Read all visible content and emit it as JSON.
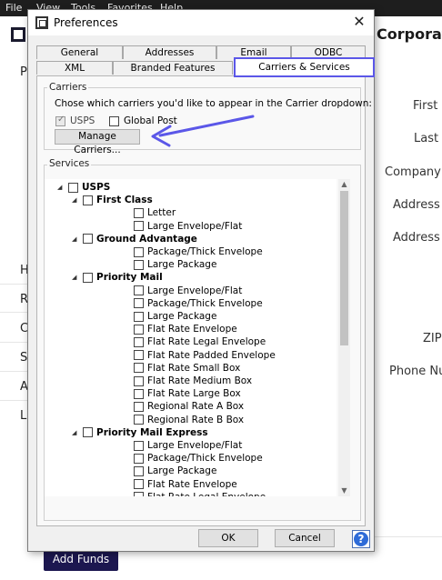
{
  "menu": [
    "File",
    "View",
    "Tools",
    "Favorites",
    "Help"
  ],
  "background": {
    "left_letters": [
      "P",
      "H",
      "R",
      "C",
      "S",
      "A",
      "L"
    ],
    "company_heading": "Corporate",
    "fields": [
      "First N",
      "Last N",
      "Company N",
      "Address L",
      "Address L",
      "ZIP",
      "Phone Nu"
    ],
    "add_funds_label": "Add Funds"
  },
  "dialog": {
    "title": "Preferences",
    "close_glyph": "✕",
    "tabs_row1": [
      "General",
      "Addresses",
      "Email",
      "ODBC"
    ],
    "tabs_row2": [
      "XML",
      "Branded Features",
      "Carriers & Services"
    ],
    "active_tab": "Carriers & Services",
    "carriers": {
      "group_label": "Carriers",
      "instruction": "Chose which carriers you'd like to appear in the Carrier dropdown:",
      "options": [
        {
          "label": "USPS",
          "checked": true,
          "disabled": true
        },
        {
          "label": "Global Post",
          "checked": false
        }
      ],
      "manage_button": "Manage Carriers..."
    },
    "services": {
      "group_label": "Services",
      "tree": [
        {
          "label": "USPS",
          "level": 0,
          "expander": "◢",
          "bold": true
        },
        {
          "label": "First Class",
          "level": 1,
          "expander": "◢",
          "bold": true
        },
        {
          "label": "Letter",
          "level": 2
        },
        {
          "label": "Large Envelope/Flat",
          "level": 2
        },
        {
          "label": "Ground Advantage",
          "level": 1,
          "expander": "◢",
          "bold": true
        },
        {
          "label": "Package/Thick Envelope",
          "level": 2
        },
        {
          "label": "Large Package",
          "level": 2
        },
        {
          "label": "Priority Mail",
          "level": 1,
          "expander": "◢",
          "bold": true
        },
        {
          "label": "Large Envelope/Flat",
          "level": 2
        },
        {
          "label": "Package/Thick Envelope",
          "level": 2
        },
        {
          "label": "Large Package",
          "level": 2
        },
        {
          "label": "Flat Rate Envelope",
          "level": 2
        },
        {
          "label": "Flat Rate Legal Envelope",
          "level": 2
        },
        {
          "label": "Flat Rate Padded Envelope",
          "level": 2
        },
        {
          "label": "Flat Rate Small Box",
          "level": 2
        },
        {
          "label": "Flat Rate Medium Box",
          "level": 2
        },
        {
          "label": "Flat Rate Large Box",
          "level": 2
        },
        {
          "label": "Regional Rate A Box",
          "level": 2
        },
        {
          "label": "Regional Rate B Box",
          "level": 2
        },
        {
          "label": "Priority Mail Express",
          "level": 1,
          "expander": "◢",
          "bold": true
        },
        {
          "label": "Large Envelope/Flat",
          "level": 2
        },
        {
          "label": "Package/Thick Envelope",
          "level": 2
        },
        {
          "label": "Large Package",
          "level": 2
        },
        {
          "label": "Flat Rate Envelope",
          "level": 2
        },
        {
          "label": "Flat Rate Legal Envelope",
          "level": 2
        }
      ]
    },
    "ok_label": "OK",
    "cancel_label": "Cancel",
    "help_label": "?",
    "scroll_up_glyph": "▲",
    "scroll_down_glyph": "▼"
  },
  "colors": {
    "active_tab_border": "#5b57e8",
    "annotation_arrow": "#5b57e8",
    "add_funds_bg": "#1c1750",
    "help_icon": "#2e6bd8"
  }
}
